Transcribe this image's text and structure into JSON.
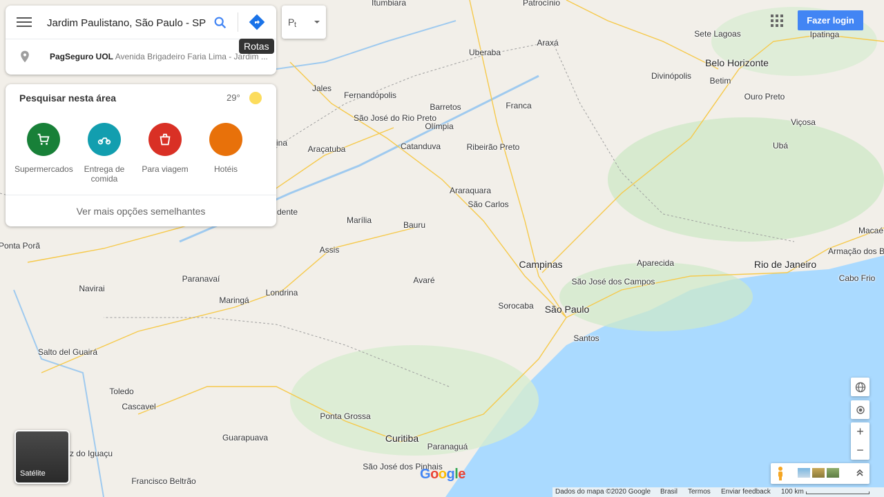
{
  "search": {
    "query": "Jardim Paulistano, São Paulo - SP",
    "suggestion_name": "PagSeguro UOL",
    "suggestion_address": "Avenida Brigadeiro Faria Lima - Jardim ...",
    "tooltip": "Rotas"
  },
  "transit_label": "⍴ₜ",
  "explore": {
    "title": "Pesquisar nesta área",
    "temperature": "29°",
    "categories": [
      {
        "label": "Supermercados",
        "color": "#188038",
        "icon": "cart-icon"
      },
      {
        "label": "Entrega de comida",
        "color": "#129eaf",
        "icon": "scooter-icon"
      },
      {
        "label": "Para viagem",
        "color": "#d93025",
        "icon": "takeout-icon"
      },
      {
        "label": "Hotéis",
        "color": "#e8710a",
        "icon": "hotel-icon"
      }
    ],
    "more": "Ver mais opções semelhantes"
  },
  "header": {
    "login": "Fazer login"
  },
  "satellite_label": "Satélite",
  "logo": "Google",
  "footer": {
    "data": "Dados do mapa ©2020 Google",
    "country": "Brasil",
    "terms": "Termos",
    "feedback": "Enviar feedback",
    "scale": "100 km"
  },
  "map": {
    "cities_big": [
      "Campinas",
      "São Paulo",
      "Belo Horizonte",
      "Rio de Janeiro",
      "Curitiba"
    ],
    "cities": [
      "Uberaba",
      "Franca",
      "Ribeirão Preto",
      "São Carlos",
      "Bauru",
      "Araraquara",
      "Sorocaba",
      "Santos",
      "São José dos Campos",
      "Londrina",
      "Maringá",
      "Cascavel",
      "Ponta Grossa",
      "Araçatuba",
      "São José do Rio Preto",
      "Toledo",
      "Guarapuava",
      "Foz do Iguaçu",
      "Divinópolis",
      "Betim",
      "Ipatinga",
      "Sete Lagoas",
      "Fernandópolis",
      "Barretos",
      "Catanduva",
      "Marília",
      "Assis",
      "Paranavaí",
      "Ubá",
      "Cabo Frio",
      "Francisco Beltrão",
      "São José dos Pinhais",
      "Paranaguá",
      "Araxá",
      "Itumbiara",
      "Patrocínio",
      "Jales",
      "Olímpia",
      "Ouro Preto",
      "Viçosa",
      "Macaé",
      "Armação dos Búzios",
      "Aparecida",
      "Avaré",
      "Navirai",
      "Salto del Guairá",
      "Ponta Porã",
      "dente",
      "ina"
    ]
  }
}
